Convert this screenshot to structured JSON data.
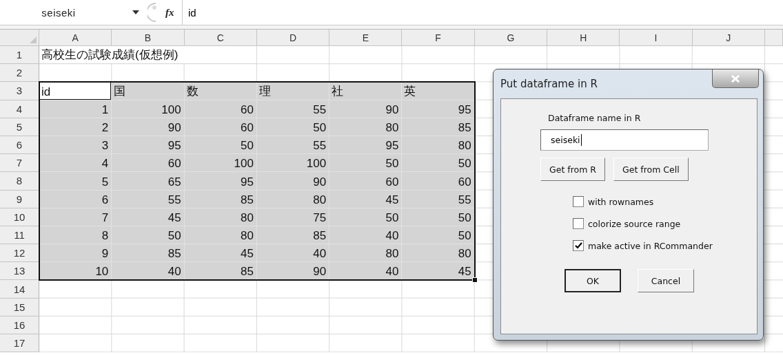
{
  "formula_bar": {
    "name_box": "seiseki",
    "function_label": "fx",
    "value": "id"
  },
  "sheet": {
    "columns": [
      "A",
      "B",
      "C",
      "D",
      "E",
      "F",
      "G",
      "H",
      "I",
      "J"
    ],
    "rows": [
      {
        "header": "1",
        "cells": [
          {
            "text": "高校生の試験成績(仮想例)",
            "kind": "text",
            "selected": false,
            "active": false
          }
        ]
      },
      {
        "header": "2"
      },
      {
        "header": "3",
        "cells": [
          {
            "text": "id",
            "kind": "text",
            "selected": true,
            "active": true
          },
          {
            "text": "国",
            "kind": "text",
            "selected": true,
            "active": false
          },
          {
            "text": "数",
            "kind": "text",
            "selected": true,
            "active": false
          },
          {
            "text": "理",
            "kind": "text",
            "selected": true,
            "active": false
          },
          {
            "text": "社",
            "kind": "text",
            "selected": true,
            "active": false
          },
          {
            "text": "英",
            "kind": "text",
            "selected": true,
            "active": false
          }
        ]
      },
      {
        "header": "4",
        "cells": [
          {
            "text": "1",
            "kind": "number",
            "selected": true,
            "active": false
          },
          {
            "text": "100",
            "kind": "number",
            "selected": true,
            "active": false
          },
          {
            "text": "60",
            "kind": "number",
            "selected": true,
            "active": false
          },
          {
            "text": "55",
            "kind": "number",
            "selected": true,
            "active": false
          },
          {
            "text": "90",
            "kind": "number",
            "selected": true,
            "active": false
          },
          {
            "text": "95",
            "kind": "number",
            "selected": true,
            "active": false
          }
        ]
      },
      {
        "header": "5",
        "cells": [
          {
            "text": "2",
            "kind": "number",
            "selected": true,
            "active": false
          },
          {
            "text": "90",
            "kind": "number",
            "selected": true,
            "active": false
          },
          {
            "text": "60",
            "kind": "number",
            "selected": true,
            "active": false
          },
          {
            "text": "50",
            "kind": "number",
            "selected": true,
            "active": false
          },
          {
            "text": "80",
            "kind": "number",
            "selected": true,
            "active": false
          },
          {
            "text": "85",
            "kind": "number",
            "selected": true,
            "active": false
          }
        ]
      },
      {
        "header": "6",
        "cells": [
          {
            "text": "3",
            "kind": "number",
            "selected": true,
            "active": false
          },
          {
            "text": "95",
            "kind": "number",
            "selected": true,
            "active": false
          },
          {
            "text": "50",
            "kind": "number",
            "selected": true,
            "active": false
          },
          {
            "text": "55",
            "kind": "number",
            "selected": true,
            "active": false
          },
          {
            "text": "95",
            "kind": "number",
            "selected": true,
            "active": false
          },
          {
            "text": "80",
            "kind": "number",
            "selected": true,
            "active": false
          }
        ]
      },
      {
        "header": "7",
        "cells": [
          {
            "text": "4",
            "kind": "number",
            "selected": true,
            "active": false
          },
          {
            "text": "60",
            "kind": "number",
            "selected": true,
            "active": false
          },
          {
            "text": "100",
            "kind": "number",
            "selected": true,
            "active": false
          },
          {
            "text": "100",
            "kind": "number",
            "selected": true,
            "active": false
          },
          {
            "text": "50",
            "kind": "number",
            "selected": true,
            "active": false
          },
          {
            "text": "50",
            "kind": "number",
            "selected": true,
            "active": false
          }
        ]
      },
      {
        "header": "8",
        "cells": [
          {
            "text": "5",
            "kind": "number",
            "selected": true,
            "active": false
          },
          {
            "text": "65",
            "kind": "number",
            "selected": true,
            "active": false
          },
          {
            "text": "95",
            "kind": "number",
            "selected": true,
            "active": false
          },
          {
            "text": "90",
            "kind": "number",
            "selected": true,
            "active": false
          },
          {
            "text": "60",
            "kind": "number",
            "selected": true,
            "active": false
          },
          {
            "text": "60",
            "kind": "number",
            "selected": true,
            "active": false
          }
        ]
      },
      {
        "header": "9",
        "cells": [
          {
            "text": "6",
            "kind": "number",
            "selected": true,
            "active": false
          },
          {
            "text": "55",
            "kind": "number",
            "selected": true,
            "active": false
          },
          {
            "text": "85",
            "kind": "number",
            "selected": true,
            "active": false
          },
          {
            "text": "80",
            "kind": "number",
            "selected": true,
            "active": false
          },
          {
            "text": "45",
            "kind": "number",
            "selected": true,
            "active": false
          },
          {
            "text": "55",
            "kind": "number",
            "selected": true,
            "active": false
          }
        ]
      },
      {
        "header": "10",
        "cells": [
          {
            "text": "7",
            "kind": "number",
            "selected": true,
            "active": false
          },
          {
            "text": "45",
            "kind": "number",
            "selected": true,
            "active": false
          },
          {
            "text": "80",
            "kind": "number",
            "selected": true,
            "active": false
          },
          {
            "text": "75",
            "kind": "number",
            "selected": true,
            "active": false
          },
          {
            "text": "50",
            "kind": "number",
            "selected": true,
            "active": false
          },
          {
            "text": "50",
            "kind": "number",
            "selected": true,
            "active": false
          }
        ]
      },
      {
        "header": "11",
        "cells": [
          {
            "text": "8",
            "kind": "number",
            "selected": true,
            "active": false
          },
          {
            "text": "50",
            "kind": "number",
            "selected": true,
            "active": false
          },
          {
            "text": "80",
            "kind": "number",
            "selected": true,
            "active": false
          },
          {
            "text": "85",
            "kind": "number",
            "selected": true,
            "active": false
          },
          {
            "text": "40",
            "kind": "number",
            "selected": true,
            "active": false
          },
          {
            "text": "50",
            "kind": "number",
            "selected": true,
            "active": false
          }
        ]
      },
      {
        "header": "12",
        "cells": [
          {
            "text": "9",
            "kind": "number",
            "selected": true,
            "active": false
          },
          {
            "text": "85",
            "kind": "number",
            "selected": true,
            "active": false
          },
          {
            "text": "45",
            "kind": "number",
            "selected": true,
            "active": false
          },
          {
            "text": "40",
            "kind": "number",
            "selected": true,
            "active": false
          },
          {
            "text": "80",
            "kind": "number",
            "selected": true,
            "active": false
          },
          {
            "text": "80",
            "kind": "number",
            "selected": true,
            "active": false
          }
        ]
      },
      {
        "header": "13",
        "cells": [
          {
            "text": "10",
            "kind": "number",
            "selected": true,
            "active": false
          },
          {
            "text": "40",
            "kind": "number",
            "selected": true,
            "active": false
          },
          {
            "text": "85",
            "kind": "number",
            "selected": true,
            "active": false
          },
          {
            "text": "90",
            "kind": "number",
            "selected": true,
            "active": false
          },
          {
            "text": "40",
            "kind": "number",
            "selected": true,
            "active": false
          },
          {
            "text": "45",
            "kind": "number",
            "selected": true,
            "active": false
          }
        ]
      },
      {
        "header": "14"
      },
      {
        "header": "15"
      },
      {
        "header": "16"
      },
      {
        "header": "17"
      }
    ]
  },
  "dialog": {
    "title": "Put dataframe in R",
    "field_label": "Dataframe name in R",
    "field_value": "seiseki",
    "source_buttons": [
      "Get from R",
      "Get from Cell"
    ],
    "checkboxes": [
      {
        "label": "with rownames",
        "checked": false
      },
      {
        "label": "colorize source range",
        "checked": false
      },
      {
        "label": "make active in RCommander",
        "checked": true
      }
    ],
    "buttons": [
      {
        "label": "OK",
        "default": true
      },
      {
        "label": "Cancel",
        "default": false
      }
    ]
  }
}
